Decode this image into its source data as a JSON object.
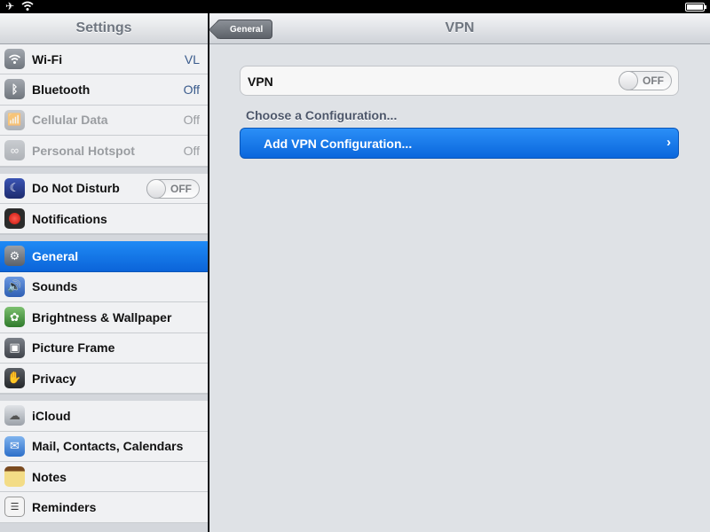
{
  "status_bar": {
    "airplane_icon": "airplane-icon",
    "wifi_icon": "wifi-icon",
    "battery_icon": "battery-icon"
  },
  "sidebar": {
    "title": "Settings",
    "groups": [
      [
        {
          "label": "Wi-Fi",
          "value": "VL",
          "icon": "wifi-icon",
          "color": "#8d939b"
        },
        {
          "label": "Bluetooth",
          "value": "Off",
          "icon": "bluetooth-icon",
          "color": "#8d939b"
        },
        {
          "label": "Cellular Data",
          "value": "Off",
          "icon": "cellular-icon",
          "color": "#8d939b"
        },
        {
          "label": "Personal Hotspot",
          "value": "Off",
          "icon": "hotspot-icon",
          "color": "#8d939b"
        }
      ],
      [
        {
          "label": "Do Not Disturb",
          "toggle": "OFF",
          "icon": "moon-icon",
          "color": "#2b3d8f"
        },
        {
          "label": "Notifications",
          "icon": "notifications-icon",
          "color": "#d9231b"
        }
      ],
      [
        {
          "label": "General",
          "icon": "gear-icon",
          "color": "#737a84"
        },
        {
          "label": "Sounds",
          "icon": "speaker-icon",
          "color": "#3d6fc4"
        },
        {
          "label": "Brightness & Wallpaper",
          "icon": "flower-icon",
          "color": "#4f9b47"
        },
        {
          "label": "Picture Frame",
          "icon": "picture-frame-icon",
          "color": "#5b6068"
        },
        {
          "label": "Privacy",
          "icon": "hand-icon",
          "color": "#3a3d42"
        }
      ],
      [
        {
          "label": "iCloud",
          "icon": "cloud-icon",
          "color": "#9ba1a9"
        },
        {
          "label": "Mail, Contacts, Calendars",
          "icon": "mail-icon",
          "color": "#3e84d6"
        },
        {
          "label": "Notes",
          "icon": "notes-icon",
          "color": "#e9c84a"
        },
        {
          "label": "Reminders",
          "icon": "reminders-icon",
          "color": "#eeeeee"
        }
      ]
    ]
  },
  "main": {
    "title": "VPN",
    "back_label": "General",
    "vpn_label": "VPN",
    "vpn_toggle": "OFF",
    "choose_label": "Choose a Configuration...",
    "add_label": "Add VPN Configuration...",
    "add_chevron": "›"
  }
}
